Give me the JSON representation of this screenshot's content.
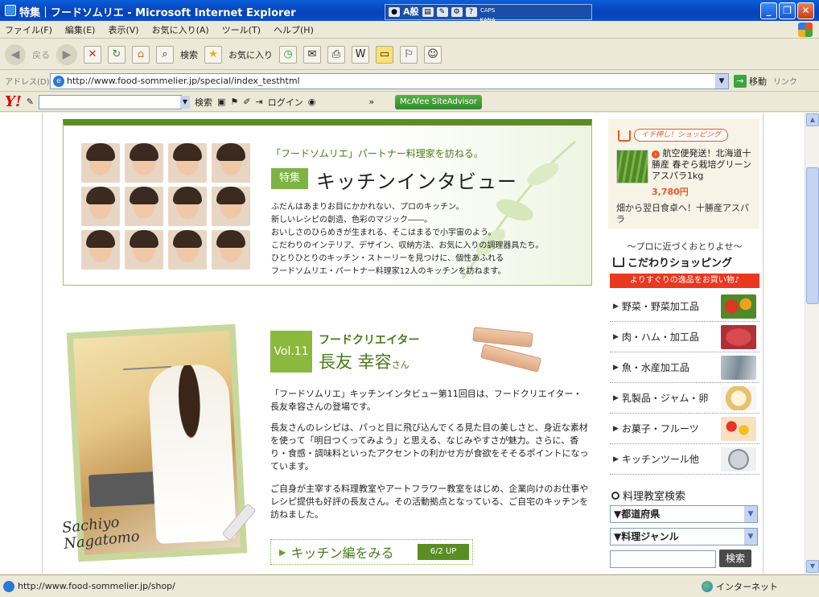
{
  "window": {
    "title": "特集｜フードソムリエ - Microsoft Internet Explorer",
    "ime_label": "A般",
    "ime_caps": "CAPS",
    "ime_kana": "KANA",
    "minimize": "_",
    "maximize": "❐",
    "close": "✕"
  },
  "menu": [
    "ファイル(F)",
    "編集(E)",
    "表示(V)",
    "お気に入り(A)",
    "ツール(T)",
    "ヘルプ(H)"
  ],
  "toolbar": {
    "back": "戻る",
    "search": "検索",
    "favorites": "お気に入り"
  },
  "address": {
    "label": "アドレス(D)",
    "url": "http://www.food-sommelier.jp/special/index_testhtml",
    "go": "移動",
    "links": "リンク"
  },
  "yahoo": {
    "logo": "Y!",
    "search_label": "検索",
    "login": "ログイン",
    "mcafee": "McAfee SiteAdvisor"
  },
  "banner": {
    "subtitle": "「フードソムリエ」パートナー料理家を訪ねる。",
    "tag": "特集",
    "title": "キッチンインタビュー",
    "body": "ふだんはあまりお目にかかれない、プロのキッチン。\n新しいレシピの創造、色彩のマジック――。\nおいしさのひらめきが生まれる、そこはまるで小宇宙のよう。\nこだわりのインテリア、デザイン、収納方法、お気に入りの調理器具たち。\nひとりひとりのキッチン・ストーリーを見つけに、個性あふれる\nフードソムリエ・パートナー料理家12人のキッチンを訪ねます。"
  },
  "article": {
    "vol": "Vol.11",
    "role": "フードクリエイター",
    "name": "長友 幸容",
    "honorific": "さん",
    "signature_line1": "Sachiyo",
    "signature_line2": "Nagatomo",
    "p1": "「フードソムリエ」キッチンインタビュー第11回目は、フードクリエイター・長友幸容さんの登場です。",
    "p2": "長友さんのレシピは、パっと目に飛び込んでくる見た目の美しさと、身近な素材を使って「明日つくってみよう」と思える、なじみやすさが魅力。さらに、香り・食感・調味料といったアクセントの利かせ方が食欲をそそるポイントになっています。",
    "p3": "ご自身が主宰する料理教室やアートフラワー教室をはじめ、企業向けのお仕事やレシピ提供も好評の長友さん。その活動拠点となっている、ご自宅のキッチンを訪ねました。",
    "more_label": "キッチン編をみる",
    "more_date": "6/2 UP"
  },
  "ad": {
    "tag": "イチ押し！ショッピング",
    "title": "航空便発送！北海道十勝産 春ぞら栽培グリーンアスパラ1kg",
    "price": "3,780円",
    "desc": "畑から翌日食卓へ！十勝産アスパラ"
  },
  "shopping": {
    "tagline": "～プロに近づくおとりよせ～",
    "title": "こだわりショッピング",
    "banner": "よりすぐりの逸品をお買い物♪",
    "items": [
      "野菜・野菜加工品",
      "肉・ハム・加工品",
      "魚・水産加工品",
      "乳製品・ジャム・卵",
      "お菓子・フルーツ",
      "キッチンツール他"
    ]
  },
  "class_search": {
    "title": "料理教室検索",
    "prefecture": "▼都道府県",
    "genre": "▼料理ジャンル",
    "button": "検索"
  },
  "status": {
    "url": "http://www.food-sommelier.jp/shop/",
    "zone": "インターネット"
  }
}
